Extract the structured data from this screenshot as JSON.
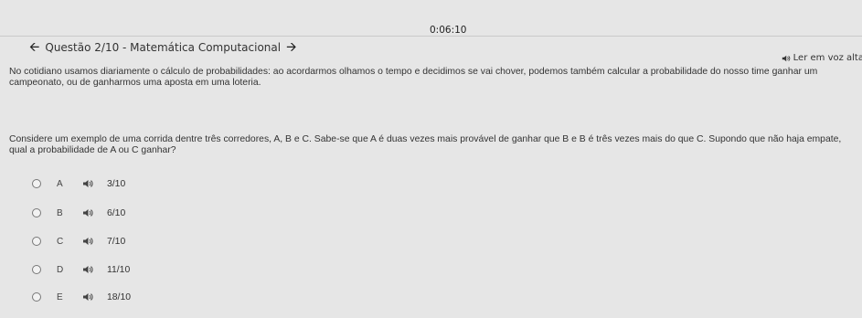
{
  "timer": "0:06:10",
  "header": {
    "title": "Questão 2/10 - Matemática Computacional"
  },
  "read_aloud_label": "Ler em voz alta",
  "intro_text": "No cotidiano usamos diariamente o cálculo de probabilidades: ao acordarmos olhamos o tempo e decidimos se vai chover, podemos também calcular a probabilidade do nosso time ganhar um campeonato, ou de ganharmos uma aposta em uma loteria.",
  "question_text": "Considere um exemplo de uma corrida dentre três corredores, A, B e C. Sabe-se que A é duas vezes mais provável de ganhar que B e B é três vezes mais do que C. Supondo que não haja empate, qual a probabilidade de A ou C ganhar?",
  "options": [
    {
      "letter": "A",
      "value": "3/10"
    },
    {
      "letter": "B",
      "value": "6/10"
    },
    {
      "letter": "C",
      "value": "7/10"
    },
    {
      "letter": "D",
      "value": "11/10"
    },
    {
      "letter": "E",
      "value": "18/10"
    }
  ]
}
